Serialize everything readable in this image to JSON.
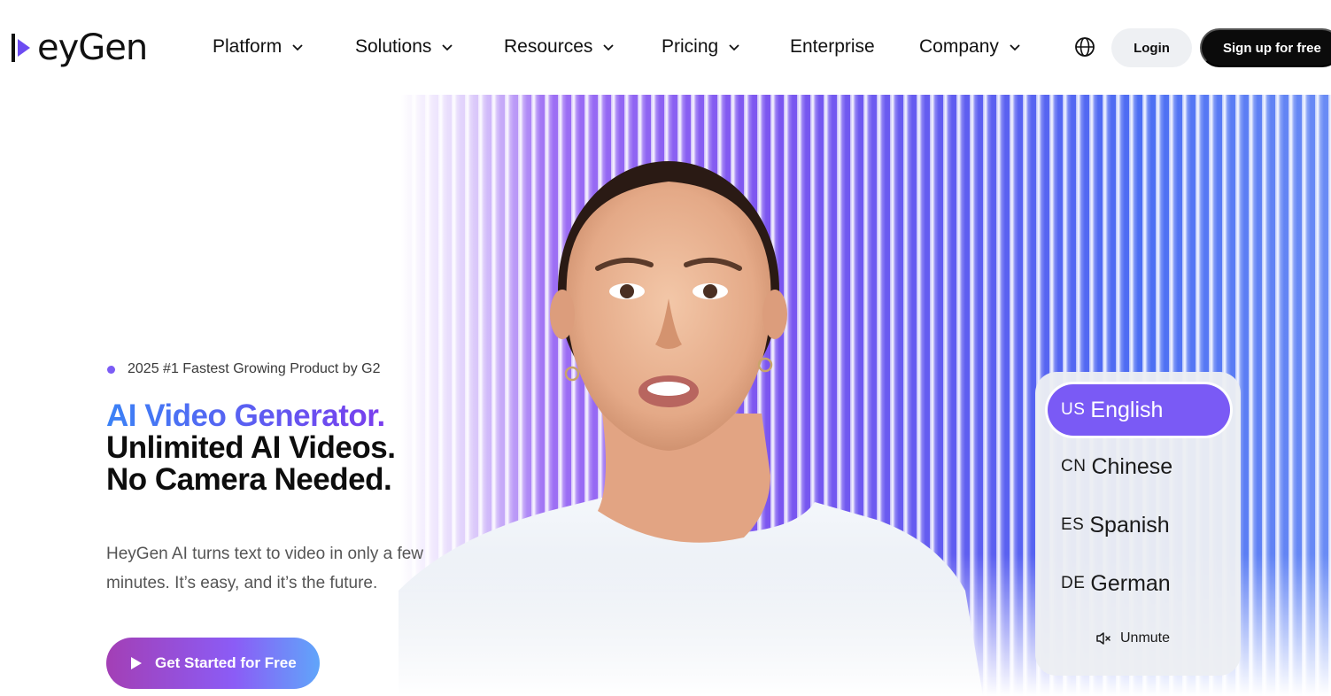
{
  "nav": {
    "logo_text": "eyGen",
    "items": [
      {
        "label": "Platform",
        "has_dropdown": true
      },
      {
        "label": "Solutions",
        "has_dropdown": true
      },
      {
        "label": "Resources",
        "has_dropdown": true
      },
      {
        "label": "Pricing",
        "has_dropdown": true
      },
      {
        "label": "Enterprise",
        "has_dropdown": false
      },
      {
        "label": "Company",
        "has_dropdown": true
      }
    ],
    "language_icon": "globe-icon",
    "login_label": "Login",
    "signup_label": "Sign up for free"
  },
  "hero": {
    "badge": "2025 #1 Fastest Growing Product by G2",
    "headline_accent": "AI Video Generator.",
    "headline_line2": "Unlimited AI Videos.",
    "headline_line3": "No Camera Needed.",
    "description": "HeyGen AI turns text to video in only a few minutes. It’s easy, and it’s the future.",
    "cta_label": "Get Started for Free"
  },
  "language_panel": {
    "languages": [
      {
        "code": "US",
        "label": "English",
        "selected": true
      },
      {
        "code": "CN",
        "label": "Chinese",
        "selected": false
      },
      {
        "code": "ES",
        "label": "Spanish",
        "selected": false
      },
      {
        "code": "DE",
        "label": "German",
        "selected": false
      }
    ],
    "unmute_label": "Unmute"
  },
  "colors": {
    "accent": "#7a5af5",
    "brand_dark": "#0b0b0b",
    "badge_dot": "#7b5cf5"
  }
}
